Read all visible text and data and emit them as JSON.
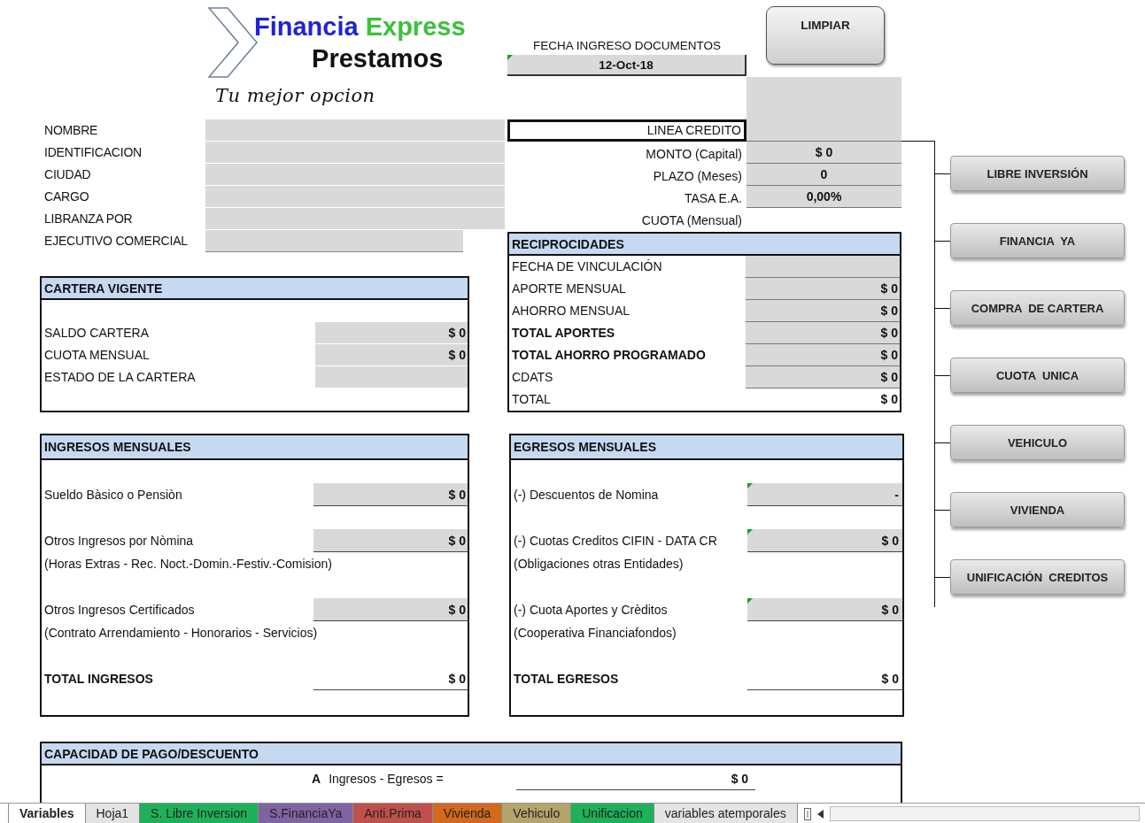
{
  "header": {
    "brand_first": "Financia",
    "brand_second": "Express",
    "product": "Prestamos",
    "slogan": "Tu mejor opcion",
    "date_label": "FECHA INGRESO DOCUMENTOS",
    "date_value": "12-Oct-18",
    "date_flagged": true,
    "clear_button": "LIMPIAR"
  },
  "client_fields": [
    {
      "label": "NOMBRE",
      "kind": "wide"
    },
    {
      "label": "IDENTIFICACION",
      "kind": "wide"
    },
    {
      "label": "CIUDAD",
      "kind": "wide"
    },
    {
      "label": "CARGO",
      "kind": "wide"
    },
    {
      "label": "LIBRANZA POR",
      "kind": "wide"
    },
    {
      "label": "EJECUTIVO COMERCIAL",
      "kind": "short"
    }
  ],
  "credit_fields": [
    {
      "label": "LINEA CREDITO",
      "kind": "input",
      "selected": true
    },
    {
      "label": "MONTO (Capital)",
      "value": "$ 0",
      "kind": "input",
      "selected": false
    },
    {
      "label": "PLAZO (Meses)",
      "value": "0",
      "kind": "input",
      "selected": false
    },
    {
      "label": "TASA E.A.",
      "value": "0,00%",
      "kind": "input",
      "selected": false
    },
    {
      "label": "CUOTA (Mensual)",
      "kind": "result",
      "selected": false
    }
  ],
  "cartera": {
    "title": "CARTERA VIGENTE",
    "rows": [
      {
        "label": "SALDO CARTERA",
        "value": "$ 0"
      },
      {
        "label": "CUOTA MENSUAL",
        "value": "$ 0"
      },
      {
        "label": "ESTADO DE LA CARTERA"
      }
    ]
  },
  "reciprocidades": {
    "title": "RECIPROCIDADES",
    "rows": [
      {
        "label": "FECHA DE VINCULACIÓN",
        "kind": "input"
      },
      {
        "label": "APORTE MENSUAL",
        "value": "$ 0",
        "kind": "input"
      },
      {
        "label": "AHORRO MENSUAL",
        "value": "$ 0",
        "kind": "input"
      },
      {
        "label": "TOTAL APORTES",
        "value": "$ 0",
        "kind": "subtotal"
      },
      {
        "label": "TOTAL AHORRO PROGRAMADO",
        "value": "$ 0",
        "kind": "subtotal"
      },
      {
        "label": "CDATS",
        "value": "$ 0",
        "kind": "input"
      },
      {
        "label": "TOTAL",
        "value": "$ 0",
        "kind": "total"
      }
    ]
  },
  "ingresos": {
    "title": "INGRESOS MENSUALES",
    "rows": [
      {
        "kind": "entry",
        "label": "Sueldo Bàsico o Pensiòn",
        "value": "$ 0"
      },
      {
        "kind": "entry",
        "label": "Otros Ingresos por Nòmina",
        "value": "$ 0"
      },
      {
        "kind": "note",
        "label": "(Horas Extras - Rec. Noct.-Domin.-Festiv.-Comision)"
      },
      {
        "kind": "entry",
        "label": "Otros Ingresos Certificados",
        "value": "$ 0"
      },
      {
        "kind": "note",
        "label": "(Contrato Arrendamiento - Honorarios - Servicios)"
      },
      {
        "kind": "total",
        "label": "TOTAL INGRESOS",
        "value": "$ 0"
      }
    ]
  },
  "egresos": {
    "title": "EGRESOS MENSUALES",
    "rows": [
      {
        "kind": "entry",
        "label": "(-) Descuentos de Nomina",
        "value": "-",
        "flagged": true
      },
      {
        "kind": "entry",
        "label": "(-) Cuotas Creditos CIFIN - DATA CR",
        "value": "$ 0",
        "flagged": true
      },
      {
        "kind": "note",
        "label": "(Obligaciones otras Entidades)"
      },
      {
        "kind": "entry",
        "label": "(-) Cuota Aportes y Crèditos",
        "value": "$ 0",
        "flagged": true
      },
      {
        "kind": "note",
        "label": "(Cooperativa Financiafondos)"
      },
      {
        "kind": "total",
        "label": "TOTAL EGRESOS",
        "value": "$ 0"
      }
    ]
  },
  "capacidad": {
    "title": "CAPACIDAD DE PAGO/DESCUENTO",
    "rows": [
      {
        "letter": "A",
        "label": "Ingresos - Egresos =",
        "value": "$ 0"
      }
    ]
  },
  "product_buttons": [
    "LIBRE INVERSIÓN",
    "FINANCIA  YA",
    "COMPRA  DE CARTERA",
    "CUOTA  UNICA",
    "VEHICULO",
    "VIVIENDA",
    "UNIFICACIÓN  CREDITOS"
  ],
  "sheet_tabs": [
    {
      "label": "Variables",
      "color": "#ffffff",
      "selected": true
    },
    {
      "label": "Hoja1",
      "color": "#e4e4e4",
      "selected": false
    },
    {
      "label": "S. Libre Inversion",
      "color": "#1fb15a",
      "selected": false
    },
    {
      "label": "S.FinanciaYa",
      "color": "#8064a2",
      "selected": false
    },
    {
      "label": "Anti.Prima",
      "color": "#c0504d",
      "selected": false
    },
    {
      "label": "Vivienda",
      "color": "#d2691e",
      "selected": false
    },
    {
      "label": "Vehiculo",
      "color": "#b3a46a",
      "selected": false
    },
    {
      "label": "Unificacion",
      "color": "#1fb15a",
      "selected": false
    },
    {
      "label": "variables atemporales",
      "color": "#e4e4e4",
      "selected": false
    }
  ]
}
